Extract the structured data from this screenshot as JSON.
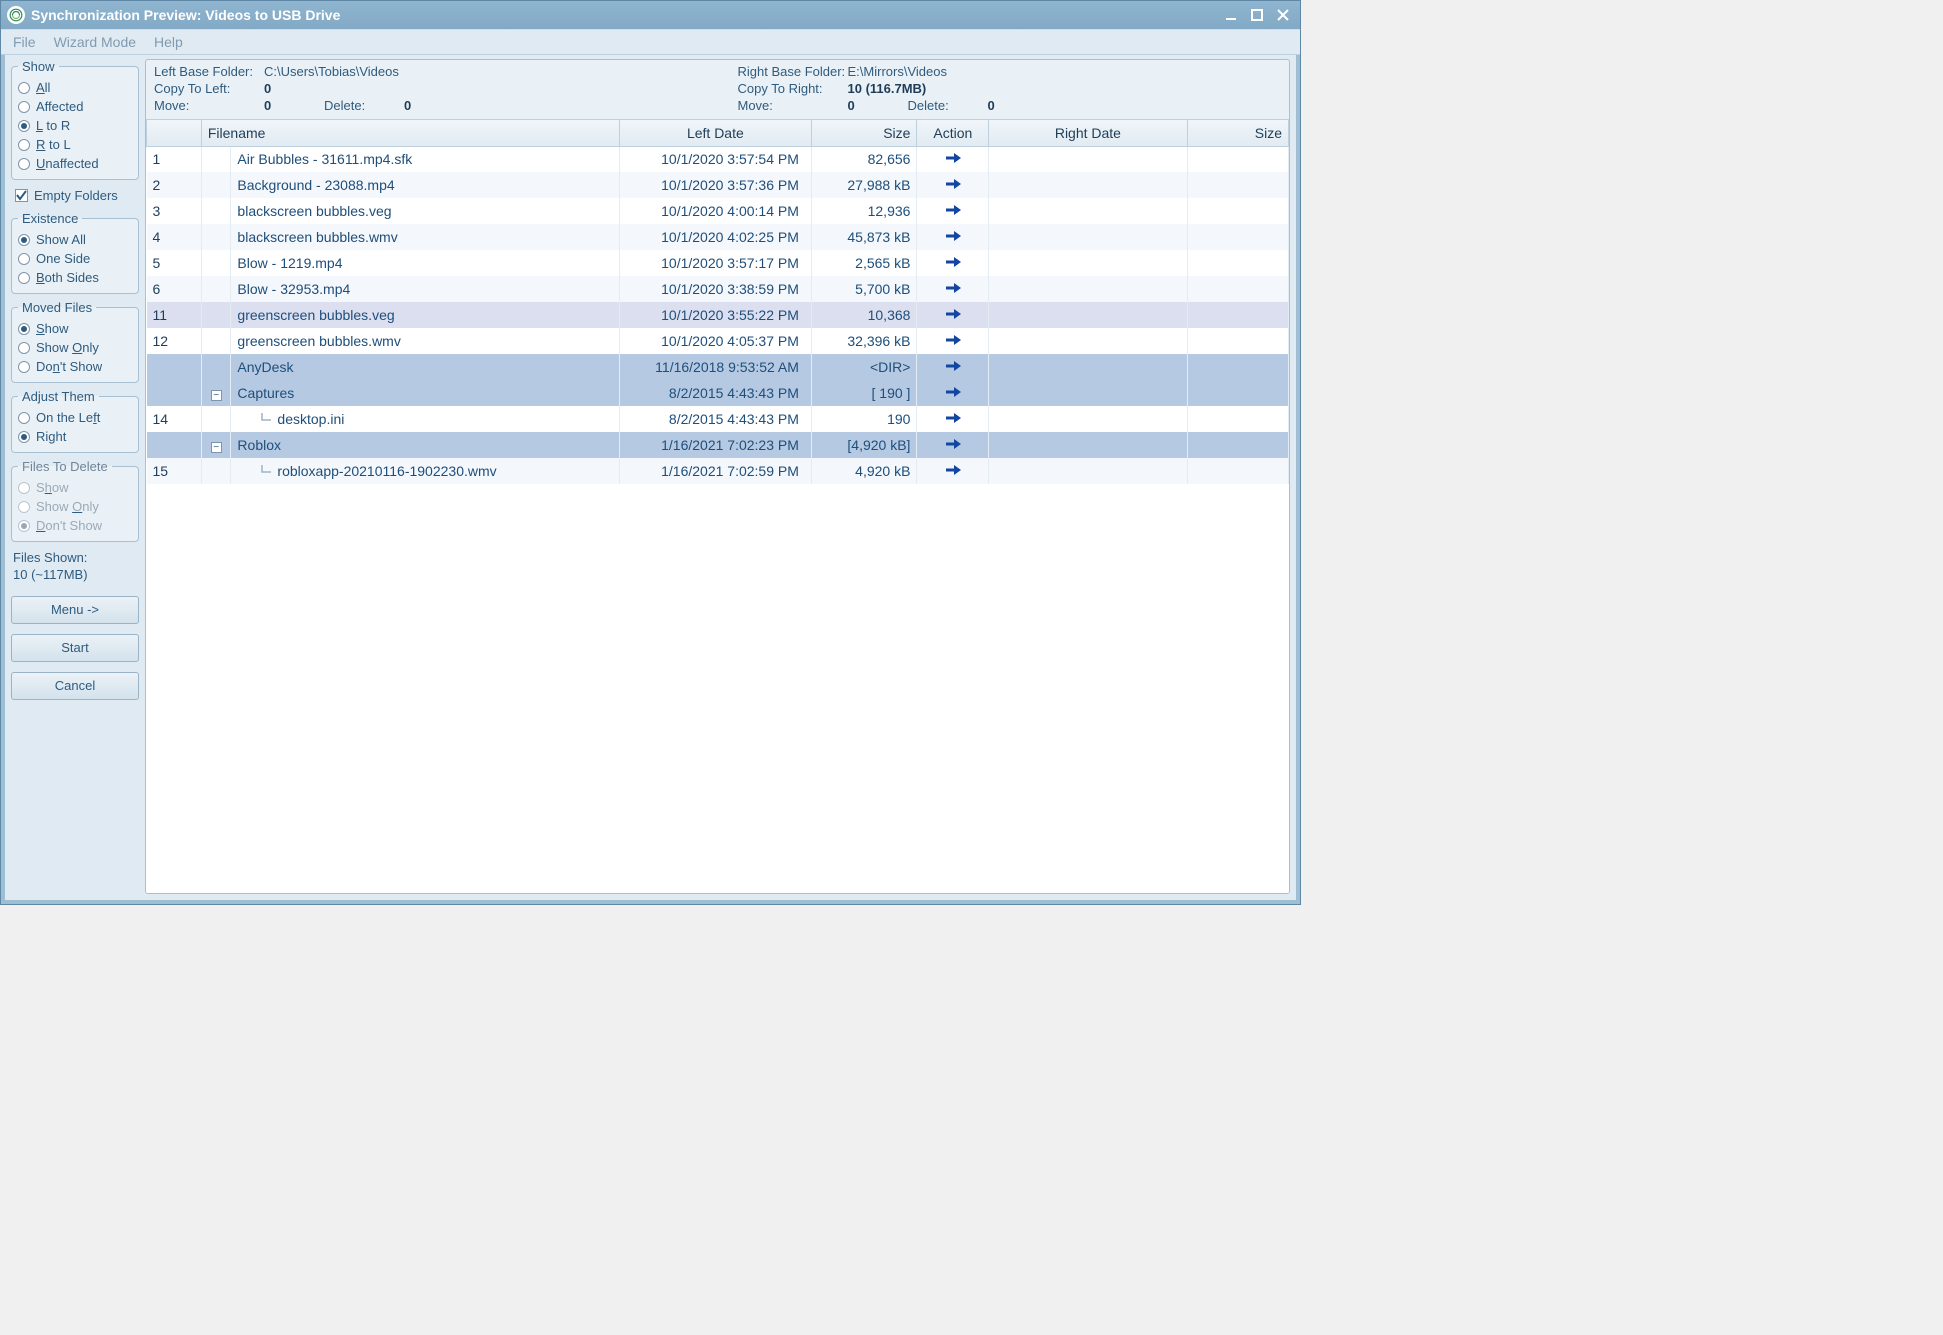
{
  "window": {
    "title": "Synchronization Preview: Videos to USB Drive"
  },
  "menubar": [
    "File",
    "Wizard Mode",
    "Help"
  ],
  "sidebar": {
    "show": {
      "legend": "Show",
      "options": [
        {
          "label": "All",
          "underline": "A",
          "checked": false
        },
        {
          "label": "Affected",
          "underline": "",
          "checked": false
        },
        {
          "label": "L to R",
          "underline": "L",
          "checked": true
        },
        {
          "label": "R to L",
          "underline": "R",
          "checked": false
        },
        {
          "label": "Unaffected",
          "underline": "U",
          "checked": false
        }
      ]
    },
    "empty_folders": {
      "label": "Empty Folders",
      "checked": true
    },
    "existence": {
      "legend": "Existence",
      "options": [
        {
          "label": "Show All",
          "checked": true
        },
        {
          "label": "One Side",
          "underline": "",
          "checked": false
        },
        {
          "label": "Both Sides",
          "underline": "B",
          "checked": false
        }
      ]
    },
    "moved": {
      "legend": "Moved Files",
      "options": [
        {
          "label": "Show",
          "underline": "S",
          "checked": true
        },
        {
          "label": "Show Only",
          "underline": "O",
          "checked": false
        },
        {
          "label": "Don't Show",
          "underline": "n",
          "checked": false
        }
      ]
    },
    "adjust": {
      "legend": "Adjust Them",
      "options": [
        {
          "label": "On the Left",
          "underline": "f",
          "checked": false
        },
        {
          "label": "Right",
          "underline": "",
          "checked": true
        }
      ]
    },
    "files_delete": {
      "legend": "Files To Delete",
      "disabled": true,
      "options": [
        {
          "label": "Show",
          "underline": "h",
          "checked": false
        },
        {
          "label": "Show Only",
          "underline": "O",
          "checked": false
        },
        {
          "label": "Don't Show",
          "underline": "D",
          "checked": true
        }
      ]
    },
    "files_shown": {
      "line1": "Files Shown:",
      "line2": "10 (~117MB)"
    },
    "buttons": {
      "menu": "Menu ->",
      "start": "Start",
      "cancel": "Cancel"
    }
  },
  "header": {
    "left": {
      "base_label": "Left Base Folder:",
      "base_value": "C:\\Users\\Tobias\\Videos",
      "copy_label": "Copy To Left:",
      "copy_value": "0",
      "move_label": "Move:",
      "move_value": "0",
      "delete_label": "Delete:",
      "delete_value": "0"
    },
    "right": {
      "base_label": "Right Base Folder:",
      "base_value": "E:\\Mirrors\\Videos",
      "copy_label": "Copy To Right:",
      "copy_value": "10 (116.7MB)",
      "move_label": "Move:",
      "move_value": "0",
      "delete_label": "Delete:",
      "delete_value": "0"
    }
  },
  "columns": {
    "filename": "Filename",
    "left_date": "Left Date",
    "left_size": "Size",
    "action": "Action",
    "right_date": "Right Date",
    "right_size": "Size"
  },
  "rows": [
    {
      "num": "1",
      "name": "Air Bubbles - 31611.mp4.sfk",
      "ldate": "10/1/2020 3:57:54 PM",
      "lsize": "82,656",
      "action": "right",
      "kind": "file"
    },
    {
      "num": "2",
      "name": "Background - 23088.mp4",
      "ldate": "10/1/2020 3:57:36 PM",
      "lsize": "27,988 kB",
      "action": "right",
      "kind": "file",
      "alt": true
    },
    {
      "num": "3",
      "name": "blackscreen bubbles.veg",
      "ldate": "10/1/2020 4:00:14 PM",
      "lsize": "12,936",
      "action": "right",
      "kind": "file"
    },
    {
      "num": "4",
      "name": "blackscreen bubbles.wmv",
      "ldate": "10/1/2020 4:02:25 PM",
      "lsize": "45,873 kB",
      "action": "right",
      "kind": "file",
      "alt": true
    },
    {
      "num": "5",
      "name": "Blow - 1219.mp4",
      "ldate": "10/1/2020 3:57:17 PM",
      "lsize": "2,565 kB",
      "action": "right",
      "kind": "file"
    },
    {
      "num": "6",
      "name": "Blow - 32953.mp4",
      "ldate": "10/1/2020 3:38:59 PM",
      "lsize": "5,700 kB",
      "action": "right",
      "kind": "file",
      "alt": true
    },
    {
      "num": "11",
      "name": "greenscreen bubbles.veg",
      "ldate": "10/1/2020 3:55:22 PM",
      "lsize": "10,368",
      "action": "right",
      "kind": "file",
      "selected": true
    },
    {
      "num": "12",
      "name": "greenscreen bubbles.wmv",
      "ldate": "10/1/2020 4:05:37 PM",
      "lsize": "32,396 kB",
      "action": "right",
      "kind": "file"
    },
    {
      "num": "",
      "name": "AnyDesk",
      "ldate": "11/16/2018 9:53:52 AM",
      "lsize": "<DIR>",
      "action": "right",
      "kind": "folder"
    },
    {
      "num": "",
      "name": "Captures",
      "ldate": "8/2/2015 4:43:43 PM",
      "lsize": "[  190  ]",
      "action": "right",
      "kind": "folder",
      "expander": "-"
    },
    {
      "num": "14",
      "name": "desktop.ini",
      "ldate": "8/2/2015 4:43:43 PM",
      "lsize": "190",
      "action": "right",
      "kind": "child"
    },
    {
      "num": "",
      "name": "Roblox",
      "ldate": "1/16/2021 7:02:23 PM",
      "lsize": "[4,920 kB]",
      "action": "right",
      "kind": "folder",
      "expander": "-"
    },
    {
      "num": "15",
      "name": "robloxapp-20210116-1902230.wmv",
      "ldate": "1/16/2021 7:02:59 PM",
      "lsize": "4,920 kB",
      "action": "right",
      "kind": "child",
      "alt": true
    }
  ]
}
